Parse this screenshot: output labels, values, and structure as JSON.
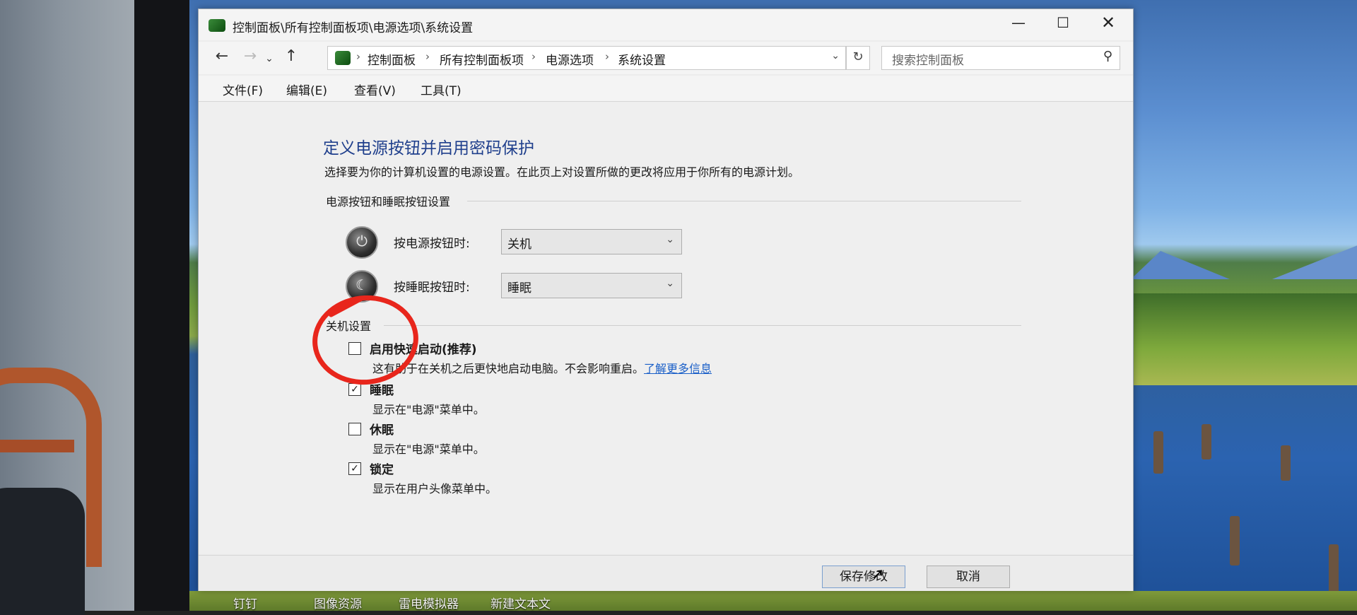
{
  "window": {
    "title": "控制面板\\所有控制面板项\\电源选项\\系统设置",
    "minimize_glyph": "—",
    "maximize_glyph": "☐",
    "close_glyph": "✕"
  },
  "nav": {
    "back_glyph": "←",
    "forward_glyph": "→",
    "recent_glyph": "⌄",
    "up_glyph": "↑",
    "breadcrumbs": [
      "控制面板",
      "所有控制面板项",
      "电源选项",
      "系统设置"
    ],
    "separator": "›",
    "dropdown_glyph": "⌄",
    "refresh_glyph": "↻",
    "search_placeholder": "搜索控制面板",
    "search_glyph": "⚲"
  },
  "menu": [
    "文件(F)",
    "编辑(E)",
    "查看(V)",
    "工具(T)"
  ],
  "page": {
    "title": "定义电源按钮并启用密码保护",
    "description": "选择要为你的计算机设置的电源设置。在此页上对设置所做的更改将应用于你所有的电源计划。"
  },
  "buttons_section": {
    "heading": "电源按钮和睡眠按钮设置",
    "power_label": "按电源按钮时:",
    "power_value": "关机",
    "sleep_label": "按睡眠按钮时:",
    "sleep_value": "睡眠"
  },
  "shutdown_section": {
    "heading": "关机设置",
    "items": [
      {
        "label": "启用快速启动(推荐)",
        "desc": "这有助于在关机之后更快地启动电脑。不会影响重启。",
        "link": "了解更多信息",
        "checked": false
      },
      {
        "label": "睡眠",
        "desc": "显示在\"电源\"菜单中。",
        "checked": true
      },
      {
        "label": "休眠",
        "desc": "显示在\"电源\"菜单中。",
        "checked": false
      },
      {
        "label": "锁定",
        "desc": "显示在用户头像菜单中。",
        "checked": true
      }
    ]
  },
  "footer": {
    "save": "保存修改",
    "cancel": "取消"
  },
  "desktop_labels": [
    "钉钉",
    "图像资源",
    "雷电模拟器",
    "新建文本文"
  ],
  "colors": {
    "annotation": "#e8261c",
    "title": "#1f3f8c",
    "link": "#1a5fc8"
  }
}
